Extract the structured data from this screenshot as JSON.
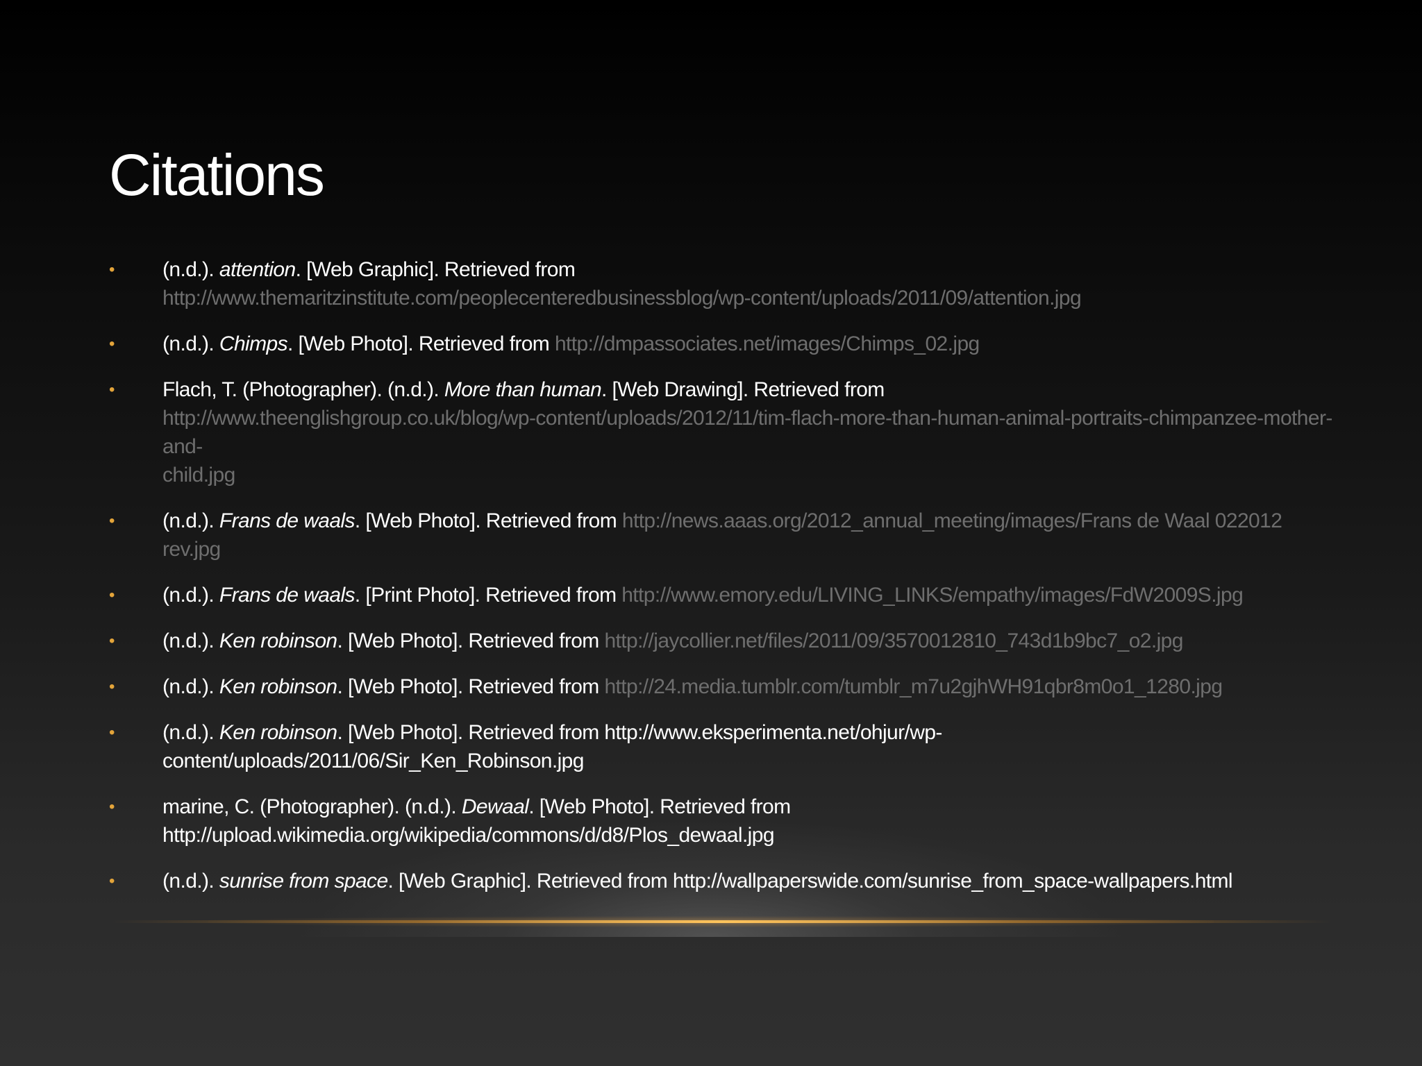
{
  "slide": {
    "title": "Citations",
    "colors": {
      "background_top": "#000000",
      "background_bottom": "#303030",
      "bullet": "#e3a43a",
      "text": "#ffffff",
      "link": "#6e6e6e",
      "horizon": "#ffc45c"
    }
  },
  "citations": [
    {
      "prefix": "(n.d.). ",
      "title": "attention",
      "suffix": ". [Web Graphic]. Retrieved from",
      "url_line1": "http://www.themaritzinstitute.com/peoplecenteredbusinessblog/wp-content/uploads/2011/09/attention.jpg"
    },
    {
      "prefix": "(n.d.). ",
      "title": "Chimps",
      "suffix": ". [Web Photo]. Retrieved from ",
      "url": "http://dmpassociates.net/images/Chimps_02.jpg"
    },
    {
      "prefix": "Flach, T. (Photographer). (n.d.). ",
      "title": "More than human",
      "suffix": ". [Web Drawing]. Retrieved from",
      "url_line1": "http://www.theenglishgroup.co.uk/blog/wp-content/uploads/2012/11/tim-flach-more-than-human-animal-portraits-chimpanzee-mother-and-",
      "url_line2": "child.jpg"
    },
    {
      "prefix": "(n.d.). ",
      "title": "Frans de waals",
      "suffix": ". [Web Photo]. Retrieved from ",
      "url": "http://news.aaas.org/2012_annual_meeting/images/Frans de Waal 022012",
      "url_line2": "rev.jpg"
    },
    {
      "prefix": "(n.d.). ",
      "title": "Frans de waals",
      "suffix": ". [Print Photo]. Retrieved from ",
      "url": "http://www.emory.edu/LIVING_LINKS/empathy/images/FdW2009S.jpg"
    },
    {
      "prefix": "(n.d.). ",
      "title": "Ken robinson",
      "suffix": ". [Web Photo]. Retrieved from ",
      "url": "http://jaycollier.net/files/2011/09/3570012810_743d1b9bc7_o2.jpg"
    },
    {
      "prefix": "(n.d.). ",
      "title": "Ken robinson",
      "suffix": ". [Web Photo]. Retrieved from ",
      "url": "http://24.media.tumblr.com/tumblr_m7u2gjhWH91qbr8m0o1_1280.jpg"
    },
    {
      "prefix": "(n.d.). ",
      "title": "Ken robinson",
      "suffix": ". [Web Photo]. Retrieved from http://www.eksperimenta.net/ohjur/wp-",
      "url_line1": "content/uploads/2011/06/Sir_Ken_Robinson.jpg"
    },
    {
      "prefix": "marine, C. (Photographer). (n.d.). ",
      "title": "Dewaal",
      "suffix": ". [Web Photo]. Retrieved from",
      "url_line1": "http://upload.wikimedia.org/wikipedia/commons/d/d8/Plos_dewaal.jpg"
    },
    {
      "prefix": "(n.d.). ",
      "title": "sunrise from space",
      "suffix": ". [Web Graphic]. Retrieved from http://wallpaperswide.com/sunrise_from_space-wallpapers.html"
    }
  ]
}
